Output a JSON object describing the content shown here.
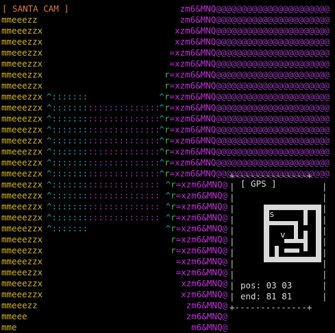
{
  "title": "[ SANTA CAM ]",
  "colors": {
    "title": "#e07a3c",
    "left": "#d4b41a",
    "cyan": "#1aa8b8",
    "purple": "#9a33b8",
    "green": "#3cc43c",
    "magenta": "#c232d8",
    "border": "#c8c8c8"
  },
  "rows": [
    {
      "prefix": "",
      "mid": "",
      "suffix": "zm6&MNQ@@@@@@@@@@@@@@@@@@@@@@"
    },
    {
      "prefix": "mmeeezz",
      "mid": "",
      "suffix": "zm6&MNQ@@@@@@@@@@@@@@@@@@@@@@"
    },
    {
      "prefix": "mmeeezzx",
      "mid": "",
      "suffix": "xzm6&MNQ@@@@@@@@@@@@@@@@@@@@@@"
    },
    {
      "prefix": "mmeeezzx",
      "mid": "",
      "suffix": "xzm6&MNQ@@@@@@@@@@@@@@@@@@@@@@"
    },
    {
      "prefix": "mmeeezzx",
      "mid": "",
      "suffix": "=xzm6&MNQ@@@@@@@@@@@@@@@@@@@@@@"
    },
    {
      "prefix": "mmeeezzx",
      "mid": "",
      "suffix": "=xzm6&MNQ@@@@@@@@@@@@@@@@@@@@@@"
    },
    {
      "prefix": "mmeeezzx",
      "mid": "",
      "suffix": "r=xzm6&MNQ@@@@@@@@@@@@@@@@@@@@@@"
    },
    {
      "prefix": "mmeeezzx",
      "mid": "",
      "suffix": "r=xzm6&MNQ@@@@@@@@@@@@@@@@@@@@@@"
    },
    {
      "prefix": "mmeeezzx",
      "mid": "^:::::::",
      "suffix": "^r=xzm6&MNQ@@@@@@@@@@@@@@@@@@@@@@"
    },
    {
      "prefix": "mmeeezzx",
      "mid": "^:::::::::::::::::::::",
      "suffix": "^r=xzm6&MNQ@@@@@@@@@@@@@@@@@@@@@@"
    },
    {
      "prefix": "mmeeezzx",
      "mid": "^:::::::::::::::::::::",
      "suffix": "^r=xzm6&MNQ@@@@@@@@@@@@@@@@@@@@@@"
    },
    {
      "prefix": "mmeeezzx",
      "mid": "^:::::::::::::::::::::",
      "suffix": "^r=xzm6&MNQ@@@@@@@@@@@@@@@@@@@@@@"
    },
    {
      "prefix": "mmeeezzx",
      "mid": "^:::::::::::::::::::::",
      "suffix": "^r=xzm6&MNQ@@@@@@@@@@@@@@@@@@@@@@"
    },
    {
      "prefix": "mmeeezzx",
      "mid": "^:::::::::::::::::::::",
      "suffix": "^r=xzm6&MNQ@@@@@@@@@@@@@@@@@@@@@@"
    },
    {
      "prefix": "mmeeezzx",
      "mid": "^:::::::::::::::::::::",
      "suffix": "^r=xzm6&MNQ@@@@@@@@@@@@@@@@@@@@@@"
    },
    {
      "prefix": "mmeeezzx",
      "mid": "^:::::::::::::::::::::",
      "suffix": "^r=xzm6&MNQ@@@@@@@@@@@@@@@@@@@@@@"
    },
    {
      "prefix": "mmeeezzx",
      "mid": "^:::::::::::::::::::::",
      "suffix": "^r=xzm6&MNQ@"
    },
    {
      "prefix": "mmeeezzx",
      "mid": "^:::::::::::::::::::::",
      "suffix": "^r=xzm6&MNQ@"
    },
    {
      "prefix": "mmeeezzx",
      "mid": "^:::::::::::::::::::::",
      "suffix": "^r=xzm6&MNQ@"
    },
    {
      "prefix": "mmeeezzx",
      "mid": "^:::::::::::::::::::::",
      "suffix": "^r=xzm6&MNQ@"
    },
    {
      "prefix": "mmeeezzx",
      "mid": "^:::::::",
      "suffix": "^r=xzm6&MNQ@"
    },
    {
      "prefix": "mmeeezzx",
      "mid": "",
      "suffix": "r=xzm6&MNQ@"
    },
    {
      "prefix": "mmeeezzx",
      "mid": "",
      "suffix": "r=xzm6&MNQ@"
    },
    {
      "prefix": "mmeeezzx",
      "mid": "",
      "suffix": "=xzm6&MNQ@"
    },
    {
      "prefix": "mmeeezzx",
      "mid": "",
      "suffix": "=xzm6&MNQ@"
    },
    {
      "prefix": "mmeeezzx",
      "mid": "",
      "suffix": "xzm6&MNQ@"
    },
    {
      "prefix": "mmeeezzx",
      "mid": "",
      "suffix": "xzm6&MNQ@"
    },
    {
      "prefix": "mmeeezz",
      "mid": "",
      "suffix": "zm6&MNQ@"
    },
    {
      "prefix": "mmeee",
      "mid": "",
      "suffix": "zm6&MNQ@"
    },
    {
      "prefix": "mme",
      "mid": "",
      "suffix": "m6&MNQ@"
    }
  ],
  "gps": {
    "border_top": "+--------------+",
    "border_bottom": "+--------------+",
    "border_side": "|",
    "title": "[ GPS ]",
    "map_marker_s": "s",
    "map_marker_v": "v",
    "pos_line": "pos: 03 03",
    "end_line": "end: 81 81"
  }
}
